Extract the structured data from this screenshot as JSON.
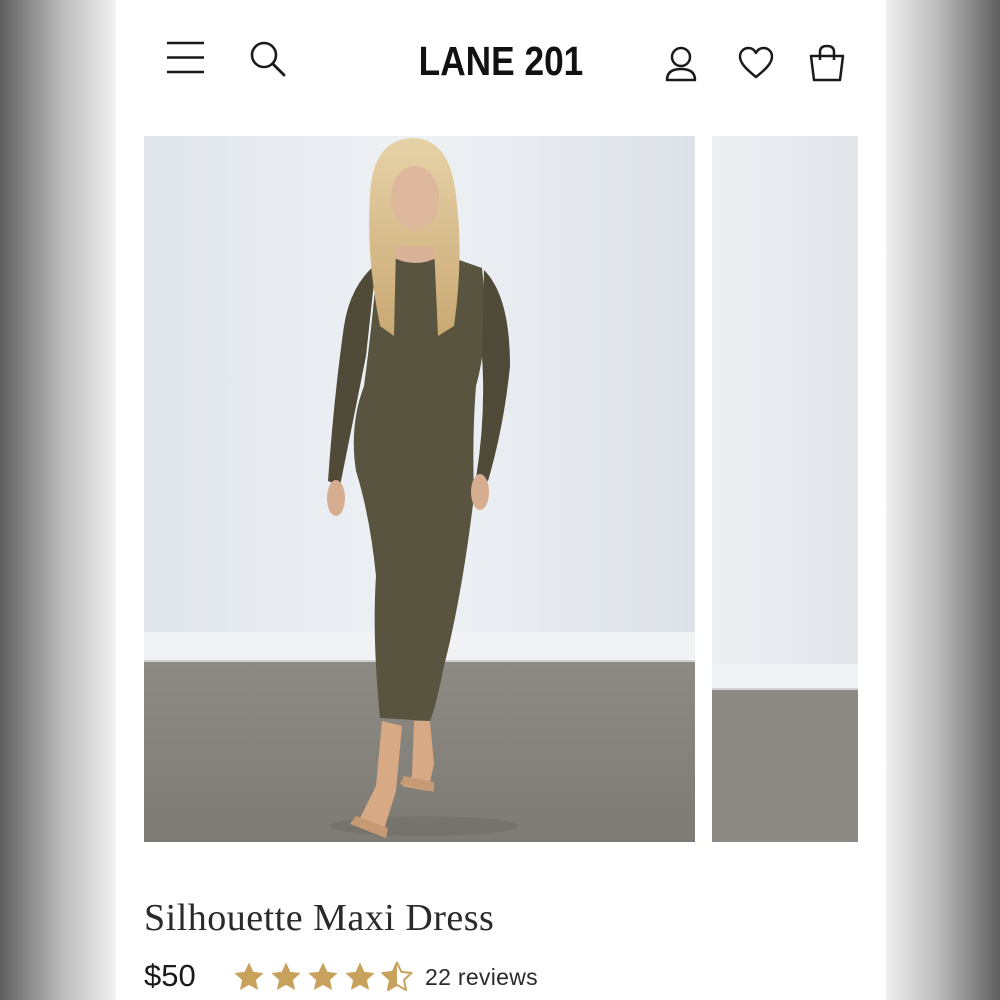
{
  "header": {
    "brand": "LANE 201",
    "icons": [
      "menu-icon",
      "search-icon",
      "account-icon",
      "heart-icon",
      "bag-icon"
    ]
  },
  "product": {
    "title": "Silhouette Maxi Dress",
    "price": "$50",
    "rating": 4.5,
    "rating_max": 5,
    "reviews": "22 reviews"
  },
  "colors": {
    "star": "#c8a25d",
    "dress": "#57533f"
  }
}
